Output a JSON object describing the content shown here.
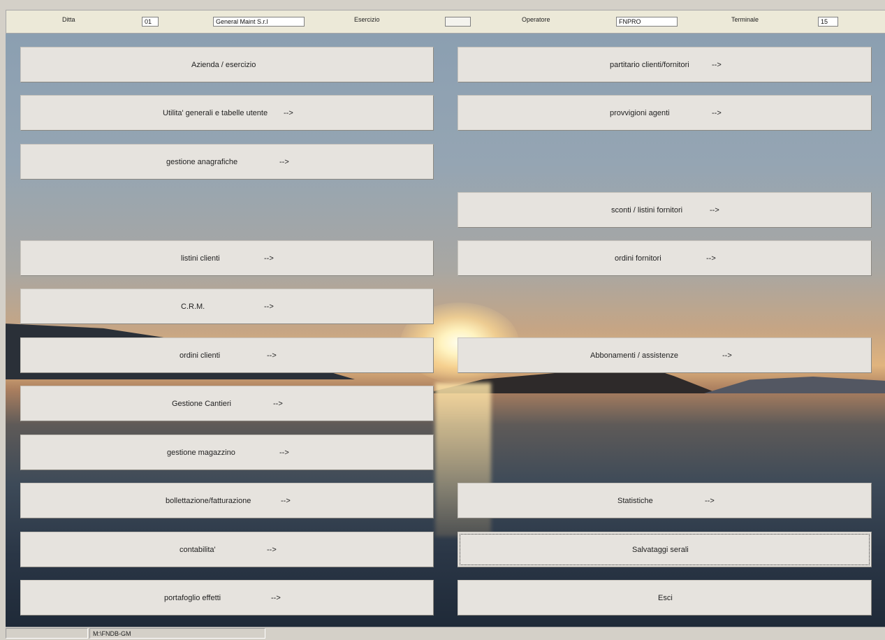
{
  "header": {
    "ditta_label": "Ditta",
    "ditta_code": "01",
    "ditta_name": "General Maint S.r.l",
    "esercizio_label": "Esercizio",
    "esercizio_value": "",
    "operatore_label": "Operatore",
    "operatore_value": "FNPRO",
    "terminale_label": "Terminale",
    "terminale_value": "15"
  },
  "menu": {
    "left": [
      {
        "label": "Azienda / esercizio",
        "arrow": ""
      },
      {
        "label": "Utilita' generali e tabelle utente",
        "arrow": "-->"
      },
      {
        "label": "gestione anagrafiche",
        "arrow": "-->"
      },
      {
        "label": "listini clienti",
        "arrow": "-->"
      },
      {
        "label": "C.R.M.",
        "arrow": "-->"
      },
      {
        "label": "ordini clienti",
        "arrow": "-->"
      },
      {
        "label": "Gestione Cantieri",
        "arrow": "-->"
      },
      {
        "label": "gestione magazzino",
        "arrow": "-->"
      },
      {
        "label": "bollettazione/fatturazione",
        "arrow": "-->"
      },
      {
        "label": "contabilita'",
        "arrow": "-->"
      },
      {
        "label": "portafoglio effetti",
        "arrow": "-->"
      }
    ],
    "right": [
      {
        "label": "partitario clienti/fornitori",
        "arrow": "-->"
      },
      {
        "label": "provvigioni agenti",
        "arrow": "-->"
      },
      {
        "label": "sconti / listini fornitori",
        "arrow": "-->"
      },
      {
        "label": "ordini fornitori",
        "arrow": "-->"
      },
      {
        "label": "Abbonamenti / assistenze",
        "arrow": "-->"
      },
      {
        "label": "Statistiche",
        "arrow": "-->"
      },
      {
        "label": "Salvataggi serali",
        "arrow": ""
      },
      {
        "label": "Esci",
        "arrow": ""
      }
    ]
  },
  "status": {
    "pane1": "",
    "path": "M:\\FNDB-GM"
  }
}
